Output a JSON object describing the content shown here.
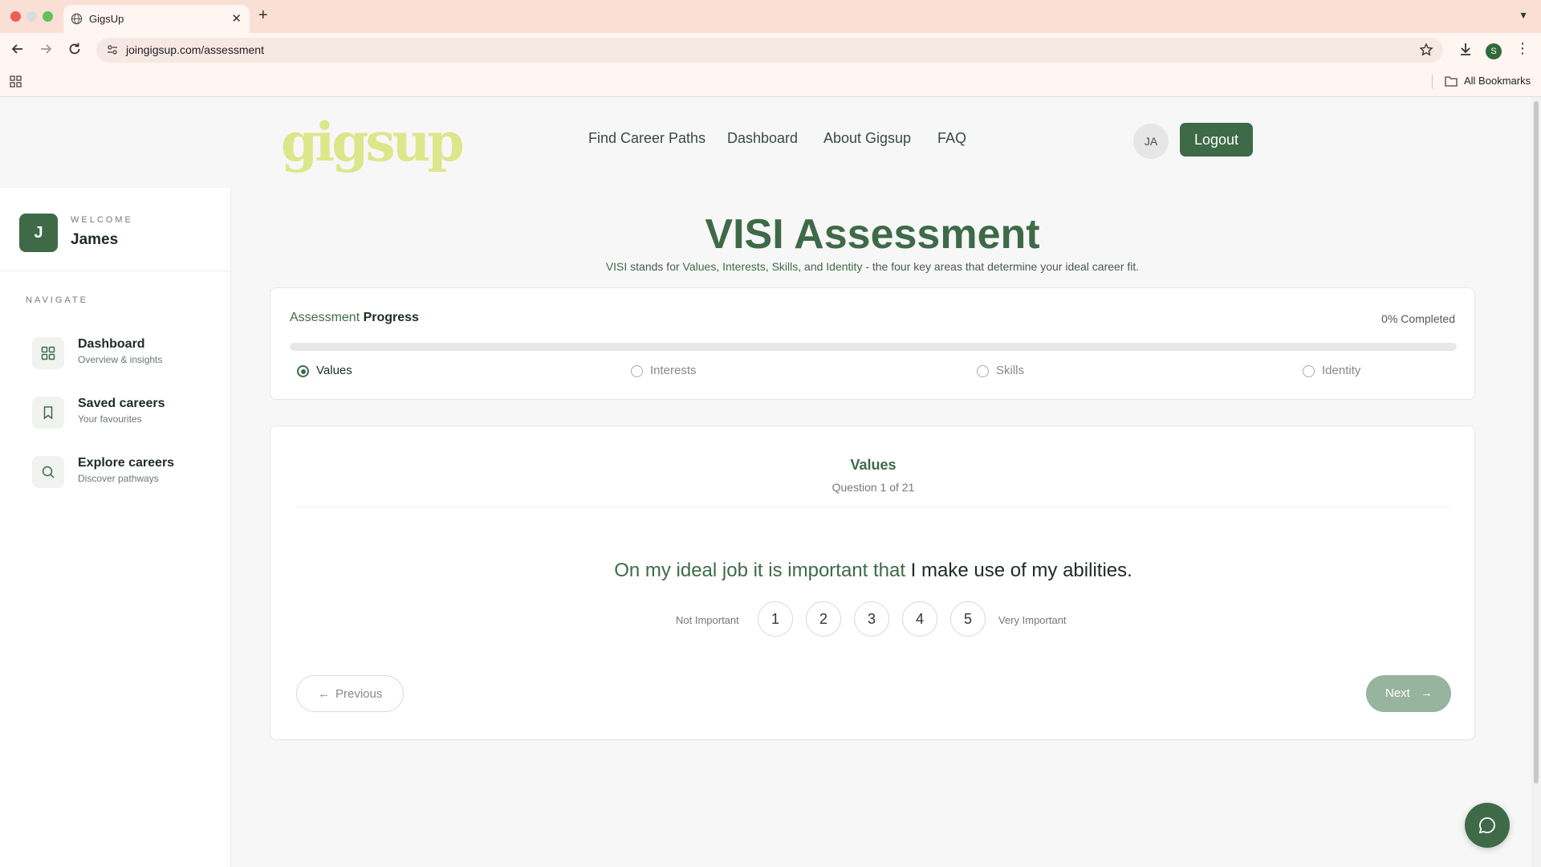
{
  "browser": {
    "tab_title": "GigsUp",
    "url": "joingigsup.com/assessment",
    "profile_initial": "S",
    "all_bookmarks": "All Bookmarks"
  },
  "header": {
    "logo": "gigsup",
    "nav": [
      "Find Career Paths",
      "Dashboard",
      "About Gigsup",
      "FAQ"
    ],
    "avatar_initials": "JA",
    "logout_label": "Logout"
  },
  "sidebar": {
    "user_initial": "J",
    "welcome_label": "WELCOME",
    "user_name": "James",
    "navigate_label": "NAVIGATE",
    "items": [
      {
        "title": "Dashboard",
        "subtitle": "Overview & insights",
        "icon": "grid-icon"
      },
      {
        "title": "Saved careers",
        "subtitle": "Your favourites",
        "icon": "bookmark-icon"
      },
      {
        "title": "Explore careers",
        "subtitle": "Discover pathways",
        "icon": "search-icon"
      }
    ]
  },
  "main": {
    "title": "VISI Assessment",
    "subtitle": {
      "visi": "VISI",
      "stands_for": " stands for ",
      "values": "Values",
      "sep1": ", ",
      "interests": "Interests",
      "sep2": ", ",
      "skills": "Skills",
      "and": ", and ",
      "identity": "Identity",
      "tail": " - the four key areas that determine your ideal career fit."
    }
  },
  "progress": {
    "title_a": "Assessment",
    "title_b": " Progress",
    "percent_label": "0% Completed",
    "percent": 0,
    "steps": [
      {
        "label": "Values",
        "active": true
      },
      {
        "label": "Interests",
        "active": false
      },
      {
        "label": "Skills",
        "active": false
      },
      {
        "label": "Identity",
        "active": false
      }
    ]
  },
  "question": {
    "section": "Values",
    "count": "Question 1 of 21",
    "lead": "On my ideal job it is important that",
    "rest": " I make use of my abilities.",
    "scale_low": "Not Important",
    "scale_high": "Very Important",
    "options": [
      "1",
      "2",
      "3",
      "4",
      "5"
    ],
    "previous_label": "Previous",
    "next_label": "Next"
  },
  "colors": {
    "brand_green": "#3e6a48",
    "logo_lime": "#dbe78a",
    "next_disabled": "#97b49e"
  }
}
